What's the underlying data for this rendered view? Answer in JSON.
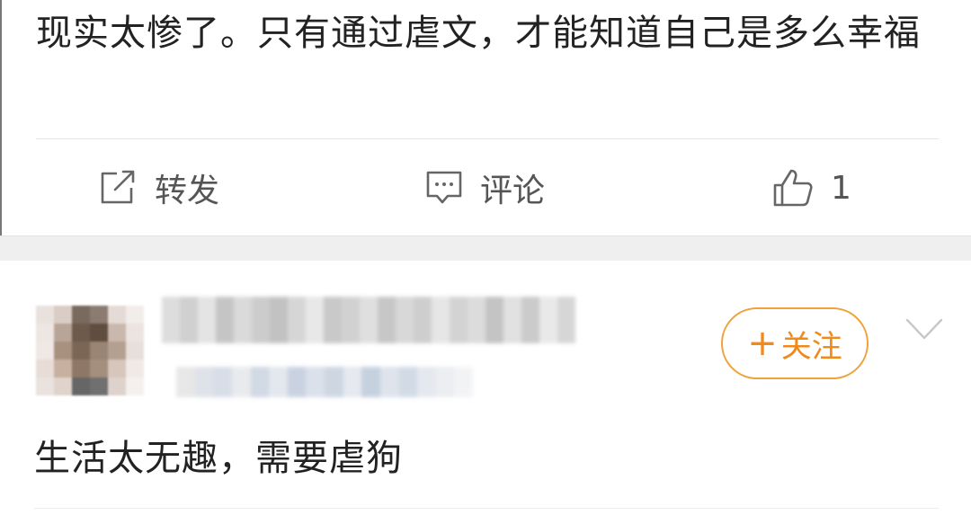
{
  "post": {
    "text": "现实太惨了。只有通过虐文，才能知道自己是多么幸福"
  },
  "actions": {
    "repost_label": "转发",
    "comment_label": "评论",
    "like_count": "1"
  },
  "comment": {
    "follow_label": "关注",
    "follow_plus": "+",
    "text": "生活太无趣，需要虐狗"
  },
  "colors": {
    "accent": "#f08a1a",
    "follow_border": "#f0a23a",
    "text": "#222222",
    "action_text": "#555555",
    "gap_band": "#efefef"
  },
  "icons": {
    "repost": "share-square-icon",
    "comment": "chat-bubble-icon",
    "like": "thumbs-up-icon",
    "more": "chevron-down-icon"
  }
}
